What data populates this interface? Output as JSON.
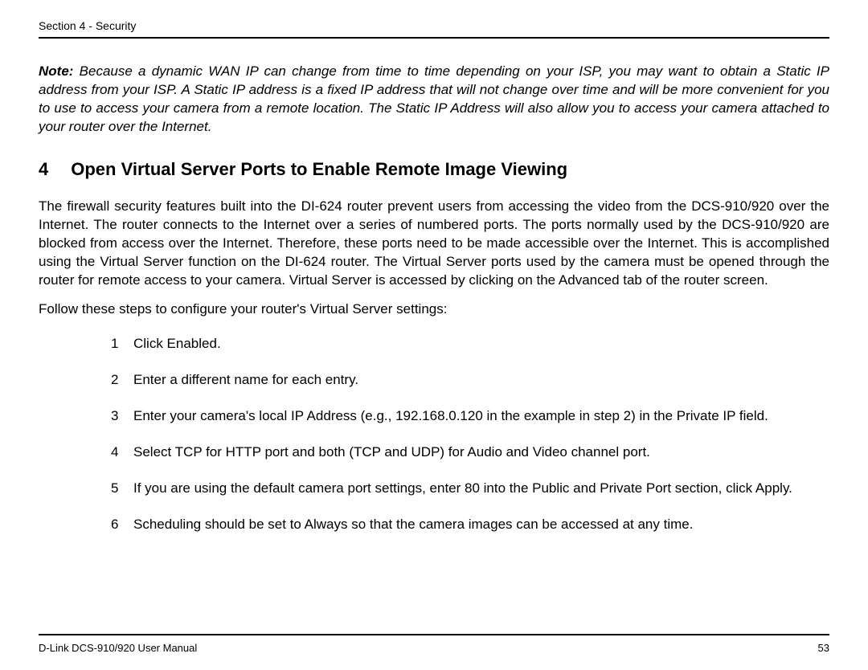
{
  "header": {
    "section": "Section 4 - Security"
  },
  "note": {
    "label": "Note:",
    "text": " Because a dynamic WAN IP can change from time to time depending on your ISP, you may want to obtain a Static IP address from your ISP. A Static IP address is a fixed IP address that will not change over time and will be more convenient for you to use to access your camera from a remote location. The Static IP Address will also allow you to access your camera attached to your router over the Internet."
  },
  "heading": {
    "number": "4",
    "title": "Open Virtual Server Ports to Enable Remote Image Viewing"
  },
  "body": {
    "paragraph": "The firewall security features built into the DI-624 router prevent users from accessing the video from the DCS-910/920 over the Internet. The router connects to the Internet over a series of numbered ports. The ports normally used by the DCS-910/920 are blocked from access over the Internet. Therefore, these ports need to be made accessible over the Internet. This is accomplished using the Virtual Server function on the DI-624 router. The Virtual Server ports used by the camera must be opened through the router for remote access to your camera. Virtual Server is accessed by clicking on the Advanced tab of the router screen.",
    "intro": "Follow these steps to configure your router's Virtual Server settings:"
  },
  "steps": [
    {
      "num": "1",
      "text": "Click Enabled."
    },
    {
      "num": "2",
      "text": "Enter a different name for each entry."
    },
    {
      "num": "3",
      "text": "Enter your camera's local IP Address (e.g., 192.168.0.120 in the example in step 2) in the Private IP field."
    },
    {
      "num": "4",
      "text": "Select TCP for HTTP port and both (TCP and UDP) for Audio and Video channel port."
    },
    {
      "num": "5",
      "text": "If you are using the default camera port settings, enter 80 into the Public and Private Port section, click Apply."
    },
    {
      "num": "6",
      "text": "Scheduling should be set to Always so that the camera images can be accessed at any time."
    }
  ],
  "footer": {
    "manual": "D-Link DCS-910/920 User Manual",
    "page": "53"
  }
}
